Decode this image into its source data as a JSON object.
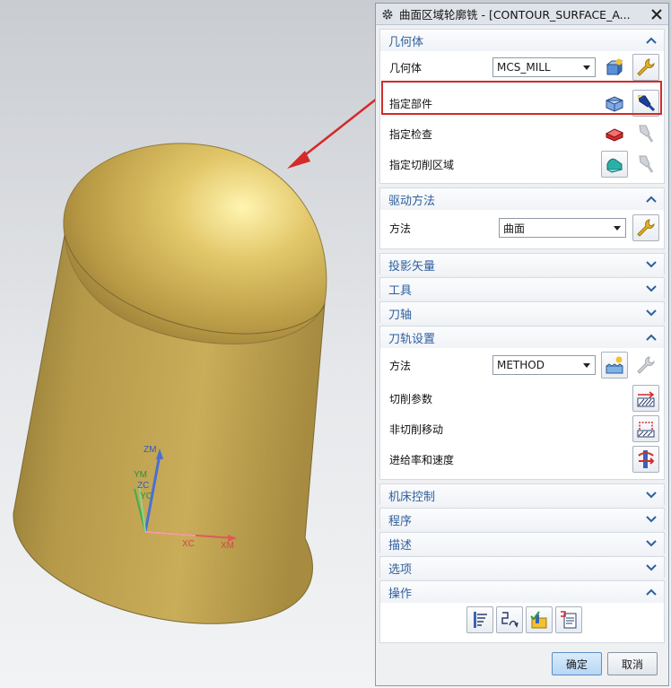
{
  "dialog": {
    "title": "曲面区域轮廓铣 - [CONTOUR_SURFACE_A...",
    "ok_label": "确定",
    "cancel_label": "取消"
  },
  "geometry": {
    "header": "几何体",
    "geometry_label": "几何体",
    "geometry_value": "MCS_MILL",
    "part_label": "指定部件",
    "check_label": "指定检查",
    "cut_area_label": "指定切削区域"
  },
  "drive": {
    "header": "驱动方法",
    "method_label": "方法",
    "method_value": "曲面"
  },
  "collapsed_top": [
    "投影矢量",
    "工具",
    "刀轴"
  ],
  "path": {
    "header": "刀轨设置",
    "method_label": "方法",
    "method_value": "METHOD",
    "cut_params_label": "切削参数",
    "non_cut_label": "非切削移动",
    "feeds_label": "进给率和速度"
  },
  "collapsed_bottom": [
    "机床控制",
    "程序",
    "描述",
    "选项"
  ],
  "actions": {
    "header": "操作"
  },
  "viewport": {
    "axis_labels": {
      "zm": "ZM",
      "ym": "YM",
      "zc": "ZC",
      "yc": "YC",
      "xc": "XC",
      "xm": "XM"
    }
  },
  "colors": {
    "accent": "#2f5f9e",
    "callout": "#d42a2a",
    "model": "#c4a84f"
  },
  "icons": [
    "gear-icon",
    "close-icon",
    "chevron-up-icon",
    "chevron-down-icon",
    "new-geometry-icon",
    "wrench-icon",
    "select-part-icon",
    "flashlight-icon",
    "select-check-icon",
    "select-cut-area-icon",
    "cut-parameters-icon",
    "non-cutting-moves-icon",
    "feeds-speeds-icon",
    "generate-icon",
    "replay-icon",
    "verify-icon",
    "list-icon"
  ]
}
